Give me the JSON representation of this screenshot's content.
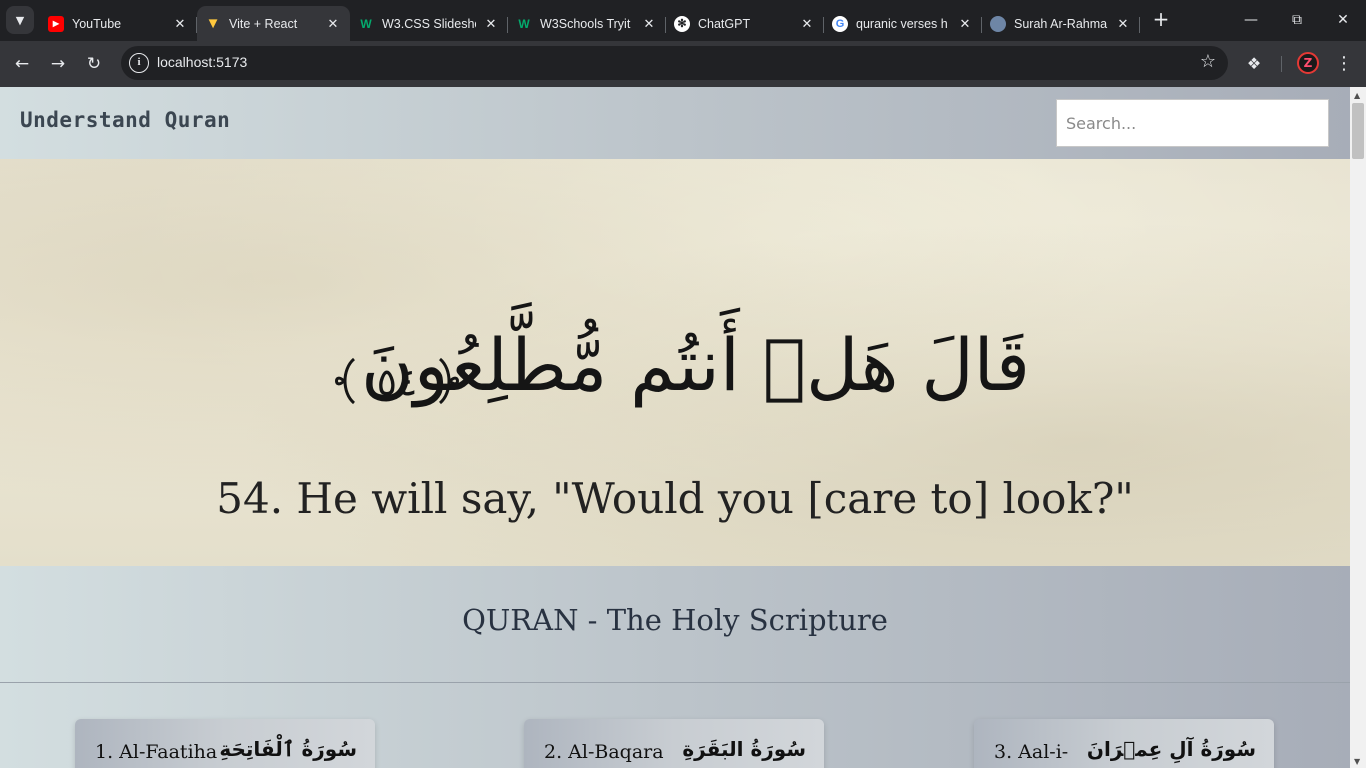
{
  "browser": {
    "tabs": [
      {
        "title": "YouTube",
        "icon": "youtube-icon",
        "color": "#ff0000"
      },
      {
        "title": "Vite + React",
        "icon": "vite-icon",
        "color": "#a86cff",
        "active": true
      },
      {
        "title": "W3.CSS Slidesho",
        "icon": "w3schools-icon",
        "color": "#04aa6d"
      },
      {
        "title": "W3Schools Tryit",
        "icon": "w3schools-icon",
        "color": "#04aa6d"
      },
      {
        "title": "ChatGPT",
        "icon": "chatgpt-icon",
        "color": "#ffffff"
      },
      {
        "title": "quranic verses h",
        "icon": "google-icon",
        "color": "#4285f4"
      },
      {
        "title": "Surah Ar-Rahma",
        "icon": "quran-site-icon",
        "color": "#6e86a6"
      }
    ],
    "url": "localhost:5173"
  },
  "navbar": {
    "brand": "Understand Quran",
    "search_placeholder": "Search..."
  },
  "hero": {
    "arabic_verse": "قَالَ هَلۡ أَنتُم مُّطَّلِعُونَ",
    "verse_number": "٥٤",
    "english": "54. He will say, \"Would you [care to] look?\""
  },
  "section": {
    "title": "QURAN - The Holy Scripture"
  },
  "surahs": [
    {
      "label": "1. Al-Faatiha",
      "arabic": "سُورَةُ ٱلْفَاتِحَةِ"
    },
    {
      "label": "2. Al-Baqara",
      "arabic": "سُورَةُ البَقَرَةِ"
    },
    {
      "label": "3. Aal-i-",
      "arabic": "سُورَةُ آلِ عِمۡرَانَ"
    }
  ]
}
